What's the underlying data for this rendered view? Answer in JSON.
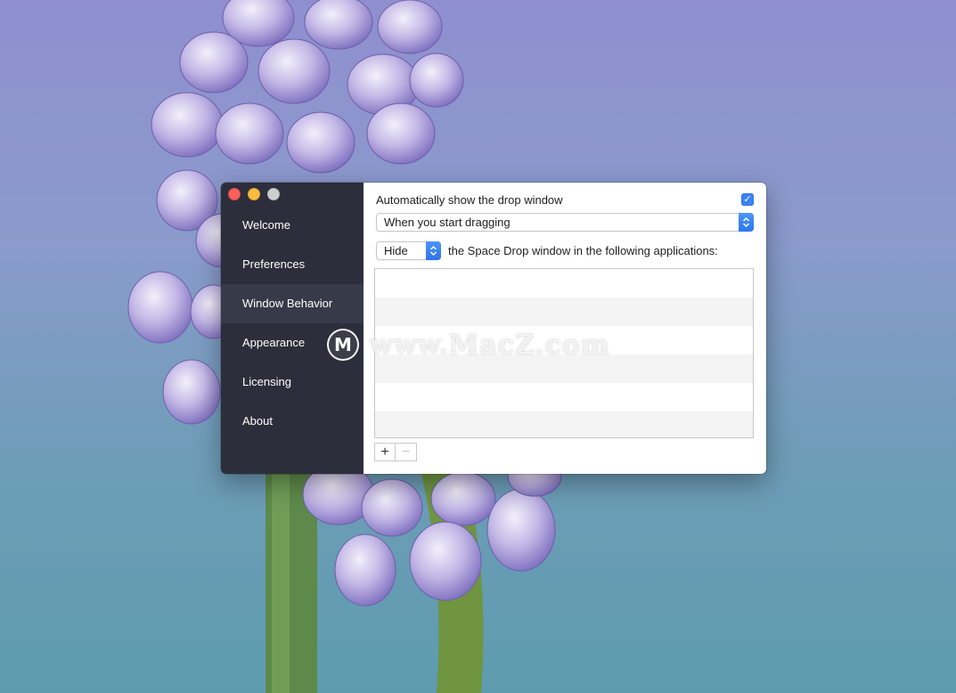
{
  "window": {
    "traffic_lights": [
      "close",
      "minimize",
      "zoom"
    ]
  },
  "sidebar": {
    "items": [
      {
        "label": "Welcome"
      },
      {
        "label": "Preferences"
      },
      {
        "label": "Window Behavior",
        "active": true
      },
      {
        "label": "Appearance"
      },
      {
        "label": "Licensing"
      },
      {
        "label": "About"
      }
    ]
  },
  "content": {
    "auto_show_label": "Automatically show the drop window",
    "auto_show_checked": true,
    "trigger_value": "When you start dragging",
    "visibility_value": "Hide",
    "apps_description": "the Space Drop window in the following applications:",
    "apps_list": [],
    "add_symbol": "+",
    "remove_symbol": "−"
  },
  "watermark": {
    "logo_letter": "M",
    "text": "www.MacZ.com"
  },
  "colors": {
    "sidebar_bg": "#2c2f3b",
    "sidebar_active": "#373a48",
    "accent": "#3a82f7"
  }
}
